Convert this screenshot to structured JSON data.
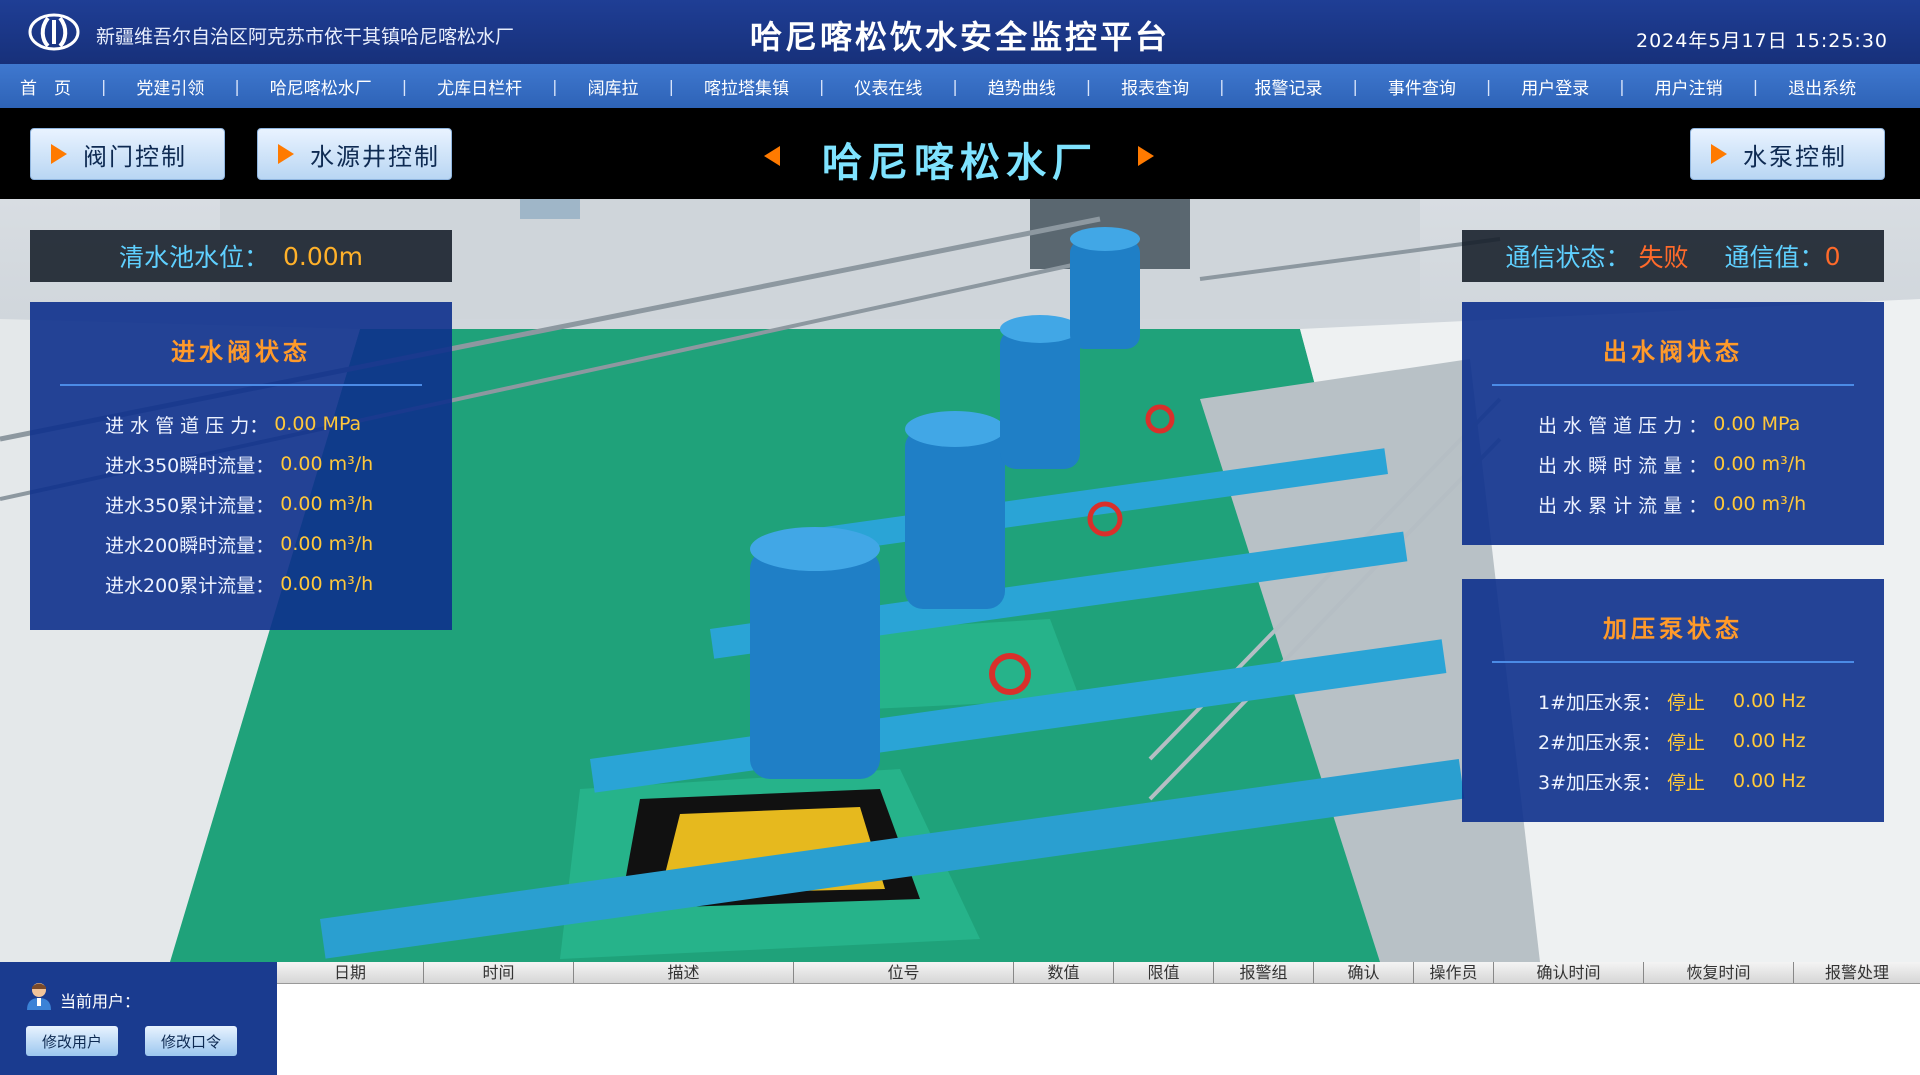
{
  "header": {
    "org_name": "新疆维吾尔自治区阿克苏市依干其镇哈尼喀松水厂",
    "platform_title": "哈尼喀松饮水安全监控平台",
    "datetime": "2024年5月17日 15:25:30"
  },
  "nav": {
    "items": [
      {
        "label": "首　页"
      },
      {
        "label": "党建引领"
      },
      {
        "label": "哈尼喀松水厂"
      },
      {
        "label": "尤库日栏杆"
      },
      {
        "label": "阔库拉"
      },
      {
        "label": "喀拉塔集镇"
      },
      {
        "label": "仪表在线"
      },
      {
        "label": "趋势曲线"
      },
      {
        "label": "报表查询"
      },
      {
        "label": "报警记录"
      },
      {
        "label": "事件查询"
      },
      {
        "label": "用户登录"
      },
      {
        "label": "用户注销"
      },
      {
        "label": "退出系统"
      }
    ]
  },
  "topbar": {
    "valve_control": "阀门控制",
    "well_control": "水源井控制",
    "plant_title": "哈尼喀松水厂",
    "pump_control": "水泵控制"
  },
  "clear_pool": {
    "label": "清水池水位：",
    "value": "0.00m"
  },
  "comm": {
    "status_label": "通信状态：",
    "status_value": "失败",
    "value_label": "通信值：",
    "value": "0"
  },
  "inlet": {
    "title": "进水阀状态",
    "rows": [
      {
        "label": "进 水 管 道 压 力：",
        "value": "0.00 MPa"
      },
      {
        "label": "进水350瞬时流量：",
        "value": "0.00 m³/h"
      },
      {
        "label": "进水350累计流量：",
        "value": "0.00 m³/h"
      },
      {
        "label": "进水200瞬时流量：",
        "value": "0.00 m³/h"
      },
      {
        "label": "进水200累计流量：",
        "value": "0.00 m³/h"
      }
    ]
  },
  "outlet": {
    "title": "出水阀状态",
    "rows": [
      {
        "label": "出 水 管 道 压 力 ：",
        "value": "0.00 MPa"
      },
      {
        "label": "出 水 瞬 时 流 量 ：",
        "value": "0.00 m³/h"
      },
      {
        "label": "出 水 累 计 流 量 ：",
        "value": "0.00 m³/h"
      }
    ]
  },
  "booster": {
    "title": "加压泵状态",
    "rows": [
      {
        "label": "1#加压水泵：",
        "state": "停止",
        "value": "0.00 Hz"
      },
      {
        "label": "2#加压水泵：",
        "state": "停止",
        "value": "0.00 Hz"
      },
      {
        "label": "3#加压水泵：",
        "state": "停止",
        "value": "0.00 Hz"
      }
    ]
  },
  "footer": {
    "current_user_label": "当前用户：",
    "modify_user": "修改用户",
    "modify_password": "修改口令"
  },
  "alarm_table": {
    "columns": [
      "日期",
      "时间",
      "描述",
      "位号",
      "数值",
      "限值",
      "报警组",
      "确认",
      "操作员",
      "确认时间",
      "恢复时间",
      "报警处理"
    ]
  },
  "colors": {
    "accent_orange": "#ff7a00",
    "value_yellow": "#ffc83a",
    "fail_red": "#ff6a2a",
    "title_cyan": "#7fe3ff"
  },
  "icons": {
    "logo": "water-drop-logo",
    "user": "user-icon",
    "arrow": "play-triangle-icon"
  }
}
